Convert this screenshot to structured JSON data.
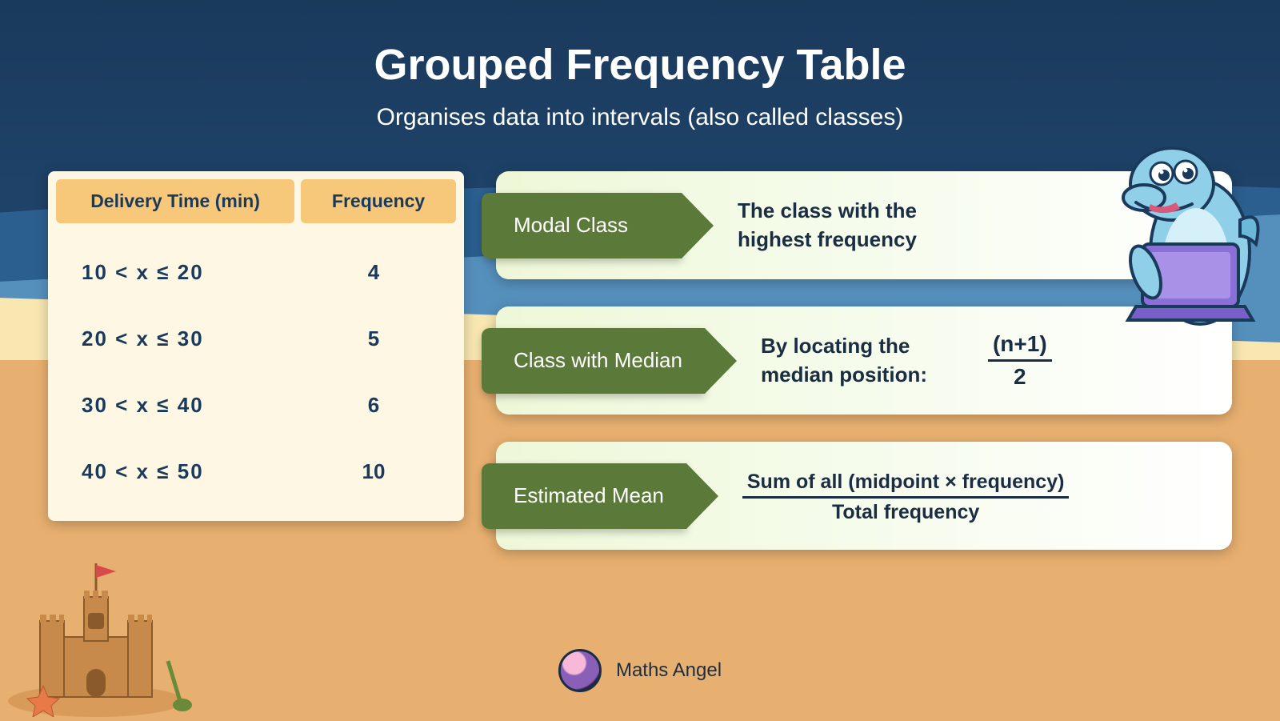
{
  "title": "Grouped Frequency Table",
  "subtitle": "Organises data into intervals (also called classes)",
  "table": {
    "header1": "Delivery Time (min)",
    "header2": "Frequency",
    "rows": [
      {
        "interval": "10  <  x  ≤  20",
        "freq": "4"
      },
      {
        "interval": "20  <  x  ≤  30",
        "freq": "5"
      },
      {
        "interval": "30  <  x  ≤  40",
        "freq": "6"
      },
      {
        "interval": "40  <  x  ≤  50",
        "freq": "10"
      }
    ]
  },
  "cards": {
    "modal": {
      "label": "Modal Class",
      "text": "The class with the highest frequency"
    },
    "median": {
      "label": "Class with Median",
      "text": "By locating the median position:",
      "frac_num": "(n+1)",
      "frac_den": "2"
    },
    "mean": {
      "label": "Estimated Mean",
      "frac_num": "Sum of all (midpoint × frequency)",
      "frac_den": "Total frequency"
    }
  },
  "footer": {
    "brand": "Maths Angel"
  }
}
